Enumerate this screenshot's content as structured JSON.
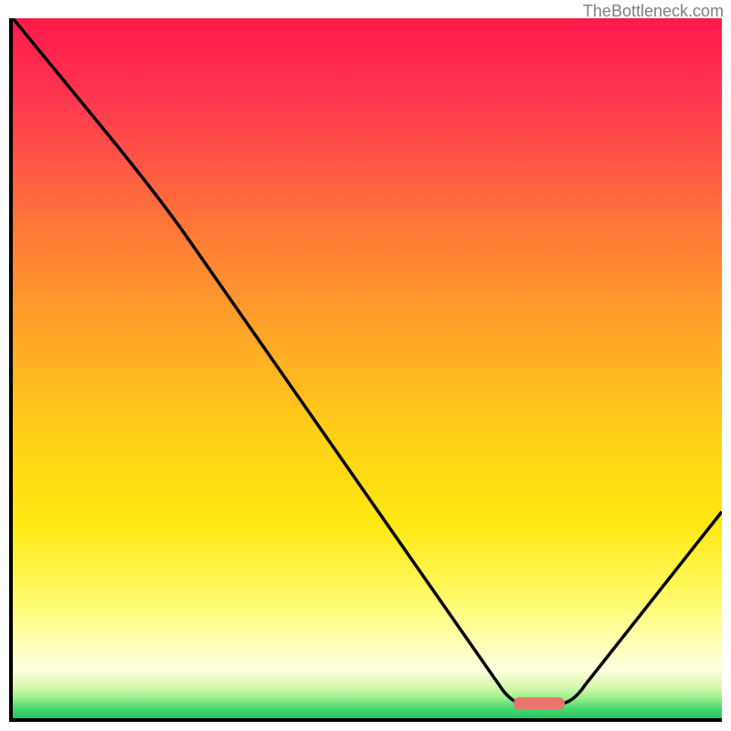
{
  "watermark": "TheBottleneck.com",
  "chart_data": {
    "type": "line",
    "title": "",
    "xlabel": "",
    "ylabel": "",
    "xlim": [
      0,
      100
    ],
    "ylim": [
      0,
      100
    ],
    "gradient_background": {
      "top_color": "#ff2050",
      "upper_mid_color": "#ff9030",
      "mid_color": "#ffe020",
      "lower_mid_color": "#fff880",
      "bottom_color": "#30d060"
    },
    "curve": {
      "description": "Bottleneck curve (V-shape)",
      "x": [
        0,
        20,
        70,
        75,
        100
      ],
      "y": [
        100,
        78,
        2,
        2,
        30
      ],
      "optimal_x": 72
    },
    "marker": {
      "x": 73,
      "y": 2.5,
      "width": 5,
      "color": "#e8766c"
    }
  }
}
